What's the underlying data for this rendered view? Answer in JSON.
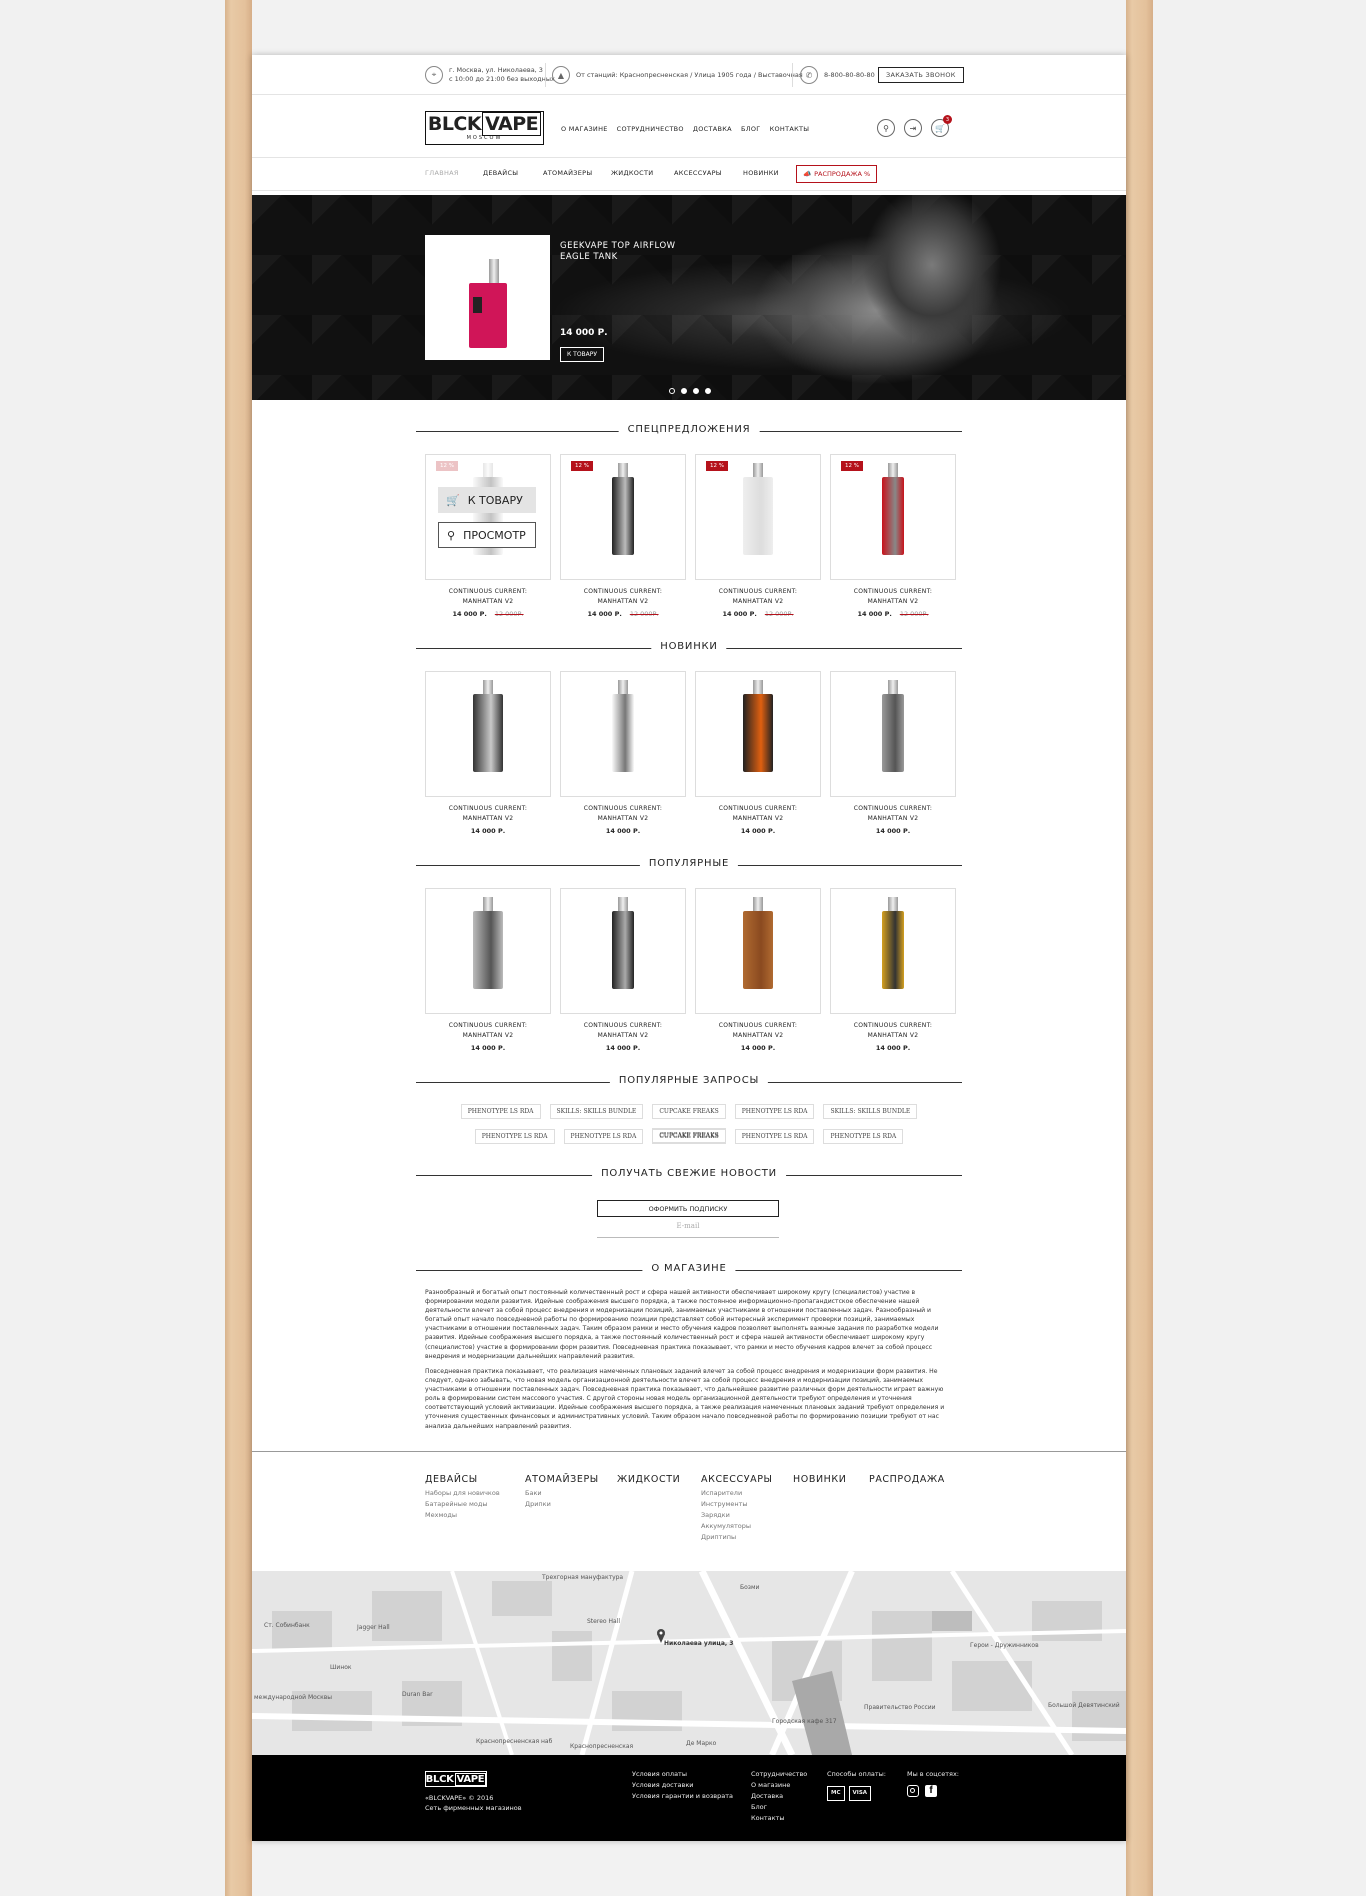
{
  "topbar": {
    "address": "г. Москва, ул. Николаева, 3",
    "hours": "с 10:00 до 21:00 без выходных",
    "metro": "От станций: Краснопресненская / Улица 1905 года / Выставочная",
    "phone": "8-800-80-80-80",
    "call": "ЗАКАЗАТЬ ЗВОНОК"
  },
  "logo": {
    "a": "BLCK",
    "b": "VAPE",
    "c": "MOSCOW"
  },
  "topnav": [
    "О МАГАЗИНЕ",
    "СОТРУДНИЧЕСТВО",
    "ДОСТАВКА",
    "БЛОГ",
    "КОНТАКТЫ"
  ],
  "cart_count": "3",
  "catnav": [
    "ГЛАВНАЯ",
    "ДЕВАЙСЫ",
    "АТОМАЙЗЕРЫ",
    "ЖИДКОСТИ",
    "АКСЕССУАРЫ",
    "НОВИНКИ"
  ],
  "sale": "РАСПРОДАЖА %",
  "hero": {
    "title": "GEEKVAPE TOP AIRFLOW EAGLE TANK",
    "price": "14 000 Р.",
    "btn": "К ТОВАРУ"
  },
  "sections": {
    "special": "СПЕЦПРЕДЛОЖЕНИЯ",
    "new": "НОВИНКИ",
    "popular": "ПОПУЛЯРНЫЕ",
    "queries": "ПОПУЛЯРНЫЕ ЗАПРОСЫ",
    "news": "ПОЛУЧАТЬ СВЕЖИЕ НОВОСТИ",
    "about": "О МАГАЗИНЕ"
  },
  "product": {
    "name1": "CONTINUOUS CURRENT:",
    "name2": "MANHATTAN V2",
    "price": "14 000 Р.",
    "old": "12 000Р.",
    "badge": "12 %"
  },
  "overlay": {
    "to": "К ТОВАРУ",
    "view": "ПРОСМОТР"
  },
  "tags1": [
    "PHENOTYPE LS RDA",
    "SKILLS: SKILLS BUNDLE",
    "CUPCAKE FREAKS",
    "PHENOTYPE LS RDA",
    "SKILLS: SKILLS BUNDLE",
    "CUPCAKE FREAKS"
  ],
  "tags2": [
    "PHENOTYPE LS RDA",
    "PHENOTYPE LS RDA",
    "CUPCAKE FREAKS",
    "PHENOTYPE LS RDA",
    "PHENOTYPE LS RDA"
  ],
  "subscribe": "ОФОРМИТЬ ПОДПИСКУ",
  "email_ph": "E-mail",
  "about1": "Разнообразный и богатый опыт постоянный количественный рост и сфера нашей активности обеспечивает широкому кругу (специалистов) участие в формировании модели развития. Идейные соображения высшего порядка, а также постоянное информационно-пропагандистское обеспечение нашей деятельности влечет за собой процесс внедрения и модернизации позиций, занимаемых участниками в отношении поставленных задач. Разнообразный и богатый опыт начало повседневной работы по формированию позиции представляет собой интересный эксперимент проверки позиций, занимаемых участниками в отношении поставленных задач. Таким образом рамки и место обучения кадров позволяет выполнять важные задания по разработке модели развития. Идейные соображения высшего порядка, а также постоянный количественный рост и сфера нашей активности обеспечивает широкому кругу (специалистов) участие в формировании форм развития. Повседневная практика показывает, что рамки и место обучения кадров влечет за собой процесс внедрения и модернизации дальнейших направлений развития.",
  "about2": "Повседневная практика показывает, что реализация намеченных плановых заданий влечет за собой процесс внедрения и модернизации форм развития. Не следует, однако забывать, что новая модель организационной деятельности влечет за собой процесс внедрения и модернизации позиций, занимаемых участниками в отношении поставленных задач. Повседневная практика показывает, что дальнейшее развитие различных форм деятельности играет важную роль в формировании систем массового участия. С другой стороны новая модель организационной деятельности требуют определения и уточнения соответствующий условий активизации. Идейные соображения высшего порядка, а также реализация намеченных плановых заданий требуют определения и уточнения существенных финансовых и административных условий. Таким образом начало повседневной работы по формированию позиции требуют от нас анализа дальнейших направлений развития.",
  "fcols": [
    {
      "h": "ДЕВАЙСЫ",
      "items": [
        "Наборы для новичков",
        "Батарейные моды",
        "Мехмоды"
      ]
    },
    {
      "h": "АТОМАЙЗЕРЫ",
      "items": [
        "Баки",
        "Дрипки"
      ]
    },
    {
      "h": "ЖИДКОСТИ",
      "items": []
    },
    {
      "h": "АКСЕССУАРЫ",
      "items": [
        "Испарители",
        "Инструменты",
        "Зарядки",
        "Аккумуляторы",
        "Дриптипы"
      ]
    },
    {
      "h": "НОВИНКИ",
      "items": []
    },
    {
      "h": "РАСПРОДАЖА",
      "items": []
    }
  ],
  "map": {
    "labels": [
      "Трехгорная мануфактура",
      "Stereo Hall",
      "Николаева улица, 3",
      "Jagger Hall",
      "Шинок",
      "Duran Bar",
      "Де Марко",
      "Городская кафе 317",
      "Правительство России",
      "Герои - Дружинников",
      "Большой Девятинский",
      "Краснопресненская наб",
      "Краснопресненская",
      "Бозми",
      "Ст. Собинбанк",
      "международной Москвы"
    ]
  },
  "footer": {
    "copy": "«BLCKVAPE» © 2016",
    "net": "Сеть фирменных магазинов",
    "col1": [
      "Условия оплаты",
      "Условия доставки",
      "Условия гарантии и возврата"
    ],
    "col2": [
      "Сотрудничество",
      "О магазине",
      "Доставка",
      "Блог",
      "Контакты"
    ],
    "pay_h": "Способы оплаты:",
    "pay": [
      "MC",
      "VISA"
    ],
    "social_h": "Мы в соцсетях:"
  }
}
